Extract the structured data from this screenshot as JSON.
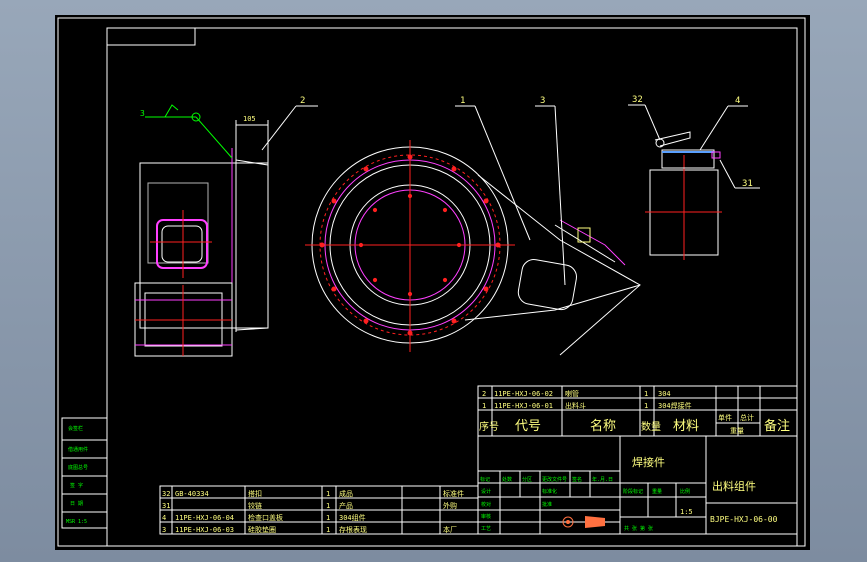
{
  "drawing": {
    "number": "BJPE-HXJ-06-00",
    "name": "出料组件",
    "part_title": "焊接件",
    "scale": "1:5",
    "std_code": "GB-40334"
  },
  "balloons": [
    "2",
    "1",
    "3",
    "32",
    "4",
    "31"
  ],
  "dimension_text": "105",
  "weld_symbol": "3",
  "bom_upper": {
    "rows": [
      {
        "no": "2",
        "code": "11PE-HXJ-06-02",
        "name": "喇管",
        "qty": "1",
        "material": "304",
        "note": ""
      },
      {
        "no": "1",
        "code": "11PE-HXJ-06-01",
        "name": "出料斗",
        "qty": "1",
        "material": "304焊接件",
        "note": ""
      }
    ],
    "header": {
      "no": "序号",
      "code": "代号",
      "name": "名称",
      "qty": "数量",
      "material": "材料",
      "weight_single": "单件",
      "weight_total": "总计",
      "weight": "重量",
      "note": "备注"
    }
  },
  "bom_lower": {
    "rows": [
      {
        "no": "32",
        "code": "GB-40334",
        "name": "搭扣",
        "qty": "1",
        "material": "成品",
        "note": "标准件"
      },
      {
        "no": "31",
        "code": "",
        "name": "铰链",
        "qty": "1",
        "material": "产品",
        "note": "外购"
      },
      {
        "no": "4",
        "code": "11PE-HXJ-06-04",
        "name": "检查口盖板",
        "qty": "1",
        "material": "304组件",
        "note": ""
      },
      {
        "no": "3",
        "code": "11PE-HXJ-06-03",
        "name": "硅胶垫圈",
        "qty": "1",
        "material": "存根表现",
        "note": "本厂"
      }
    ]
  },
  "left_strip": [
    "会签栏",
    "借通用件",
    "底图总号",
    "签 字",
    "日 期",
    "MSR 1:5"
  ],
  "title_block": {
    "labels_row": [
      "标记",
      "处数",
      "分区",
      "更改文件号",
      "签名",
      "年.月.日"
    ],
    "staff": [
      "设计",
      "校对",
      "审核",
      "工艺",
      "标准化",
      "批准"
    ],
    "stage_labels": [
      "阶段标记",
      "重量",
      "比例"
    ],
    "sheet_info": "共 张 第 张"
  },
  "colors": {
    "background": "#000000",
    "frame": "#ffffff",
    "outline": "#ffffff",
    "center": "#ff2020",
    "hidden": "#ff40ff",
    "leader": "#00ff00",
    "annotation": "#ffff80"
  }
}
